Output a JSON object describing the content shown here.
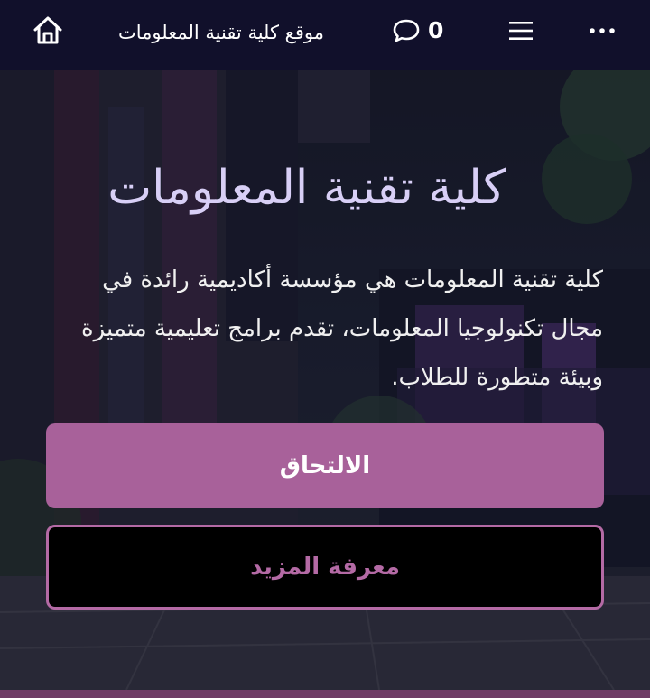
{
  "topbar": {
    "home_icon": "home-icon",
    "title": "موقع كلية تقنية المعلومات",
    "chat_icon": "chat-bubble-icon",
    "comment_count": "0",
    "menu_icon": "hamburger-menu-icon",
    "more_icon": "more-dots-icon"
  },
  "hero": {
    "title": "كلية تقنية المعلومات",
    "description": "كلية تقنية المعلومات هي مؤسسة أكاديمية رائدة في مجال تكنولوجيا المعلومات، تقدم برامج تعليمية متميزة وبيئة متطورة للطلاب.",
    "primary_button": "الالتحاق",
    "secondary_button": "معرفة المزيد"
  },
  "colors": {
    "topbar_bg": "#11102b",
    "title_color": "#d8cff6",
    "primary_button_bg": "#a8619a",
    "secondary_button_border": "#b46aa5",
    "bottom_strip": "#6e3c66"
  }
}
